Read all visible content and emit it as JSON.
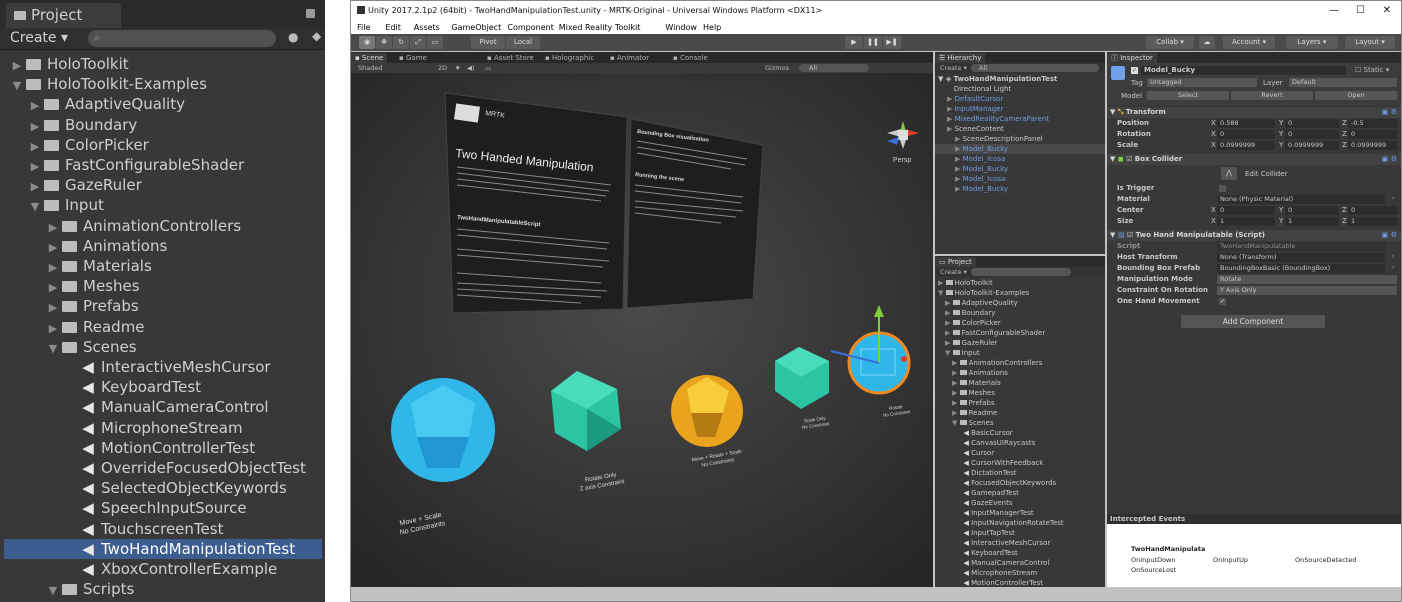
{
  "left_project": {
    "tab_title": "Project",
    "create_label": "Create",
    "tree": [
      {
        "label": "HoloToolkit",
        "depth": 0,
        "fold": "right",
        "icon": "folder"
      },
      {
        "label": "HoloToolkit-Examples",
        "depth": 0,
        "fold": "down",
        "icon": "folder"
      },
      {
        "label": "AdaptiveQuality",
        "depth": 1,
        "fold": "right",
        "icon": "folder"
      },
      {
        "label": "Boundary",
        "depth": 1,
        "fold": "right",
        "icon": "folder"
      },
      {
        "label": "ColorPicker",
        "depth": 1,
        "fold": "right",
        "icon": "folder"
      },
      {
        "label": "FastConfigurableShader",
        "depth": 1,
        "fold": "right",
        "icon": "folder"
      },
      {
        "label": "GazeRuler",
        "depth": 1,
        "fold": "right",
        "icon": "folder"
      },
      {
        "label": "Input",
        "depth": 1,
        "fold": "down",
        "icon": "folder"
      },
      {
        "label": "AnimationControllers",
        "depth": 2,
        "fold": "right",
        "icon": "folder"
      },
      {
        "label": "Animations",
        "depth": 2,
        "fold": "right",
        "icon": "folder"
      },
      {
        "label": "Materials",
        "depth": 2,
        "fold": "right",
        "icon": "folder"
      },
      {
        "label": "Meshes",
        "depth": 2,
        "fold": "right",
        "icon": "folder"
      },
      {
        "label": "Prefabs",
        "depth": 2,
        "fold": "right",
        "icon": "folder"
      },
      {
        "label": "Readme",
        "depth": 2,
        "fold": "right",
        "icon": "folder"
      },
      {
        "label": "Scenes",
        "depth": 2,
        "fold": "down",
        "icon": "folder"
      },
      {
        "label": "InteractiveMeshCursor",
        "depth": 3,
        "fold": "",
        "icon": "unity"
      },
      {
        "label": "KeyboardTest",
        "depth": 3,
        "fold": "",
        "icon": "unity"
      },
      {
        "label": "ManualCameraControl",
        "depth": 3,
        "fold": "",
        "icon": "unity"
      },
      {
        "label": "MicrophoneStream",
        "depth": 3,
        "fold": "",
        "icon": "unity"
      },
      {
        "label": "MotionControllerTest",
        "depth": 3,
        "fold": "",
        "icon": "unity"
      },
      {
        "label": "OverrideFocusedObjectTest",
        "depth": 3,
        "fold": "",
        "icon": "unity"
      },
      {
        "label": "SelectedObjectKeywords",
        "depth": 3,
        "fold": "",
        "icon": "unity"
      },
      {
        "label": "SpeechInputSource",
        "depth": 3,
        "fold": "",
        "icon": "unity"
      },
      {
        "label": "TouchscreenTest",
        "depth": 3,
        "fold": "",
        "icon": "unity"
      },
      {
        "label": "TwoHandManipulationTest",
        "depth": 3,
        "fold": "",
        "icon": "unity",
        "selected": true
      },
      {
        "label": "XboxControllerExample",
        "depth": 3,
        "fold": "",
        "icon": "unity"
      },
      {
        "label": "Scripts",
        "depth": 2,
        "fold": "down",
        "icon": "folder"
      }
    ]
  },
  "window": {
    "title": "Unity 2017.2.1p2 (64bit) - TwoHandManipulationTest.unity - MRTK-Original - Universal Windows Platform <DX11>",
    "menu": [
      "File",
      "Edit",
      "Assets",
      "GameObject",
      "Component",
      "Mixed Reality Toolkit",
      "Window",
      "Help"
    ]
  },
  "toolbar": {
    "pivot": "Pivot",
    "local": "Local",
    "collab": "Collab",
    "account": "Account",
    "layers": "Layers",
    "layout": "Layout"
  },
  "scene": {
    "tabs": [
      "Scene",
      "Game",
      "Asset Store",
      "Holographic",
      "Animator",
      "Console"
    ],
    "shaded": "Shaded",
    "mode_2d": "2D",
    "gizmos": "Gizmos",
    "all": "All",
    "persp": "Persp",
    "panel_title": "Two Handed Manipulation",
    "panel_heading2": "TwoHandManipulatableScript",
    "panel_right_heading": "Bounding Box visualization",
    "panel_right_heading2": "Running the scene",
    "brand": "MRTK",
    "labels": [
      "Move + Scale\nNo Constraints",
      "Rotate Only\nZ axis Constraint",
      "Move + Rotate + Scale\nNo Constraints",
      "Scale Only\nNo Constraint",
      "Rotate\nNo Constraint"
    ]
  },
  "hierarchy": {
    "tab": "Hierarchy",
    "create": "Create",
    "all": "All",
    "root": "TwoHandManipulationTest",
    "items": [
      {
        "label": "Directional Light",
        "indent": 1,
        "blue": false
      },
      {
        "label": "DefaultCursor",
        "indent": 1,
        "blue": true,
        "fold": true
      },
      {
        "label": "InputManager",
        "indent": 1,
        "blue": true,
        "fold": true
      },
      {
        "label": "MixedRealityCameraParent",
        "indent": 1,
        "blue": true,
        "fold": true
      },
      {
        "label": "SceneContent",
        "indent": 1,
        "blue": false,
        "fold": true
      },
      {
        "label": "SceneDescriptionPanel",
        "indent": 2,
        "blue": false,
        "fold": true
      },
      {
        "label": "Model_Bucky",
        "indent": 2,
        "blue": true,
        "fold": true,
        "selected": true
      },
      {
        "label": "Model_Icosa",
        "indent": 2,
        "blue": true,
        "fold": true
      },
      {
        "label": "Model_Bucky",
        "indent": 2,
        "blue": true,
        "fold": true
      },
      {
        "label": "Model_Icosa",
        "indent": 2,
        "blue": true,
        "fold": true
      },
      {
        "label": "Model_Bucky",
        "indent": 2,
        "blue": true,
        "fold": true
      }
    ]
  },
  "project_small": {
    "tab": "Project",
    "create": "Create",
    "items": [
      {
        "label": "HoloToolkit",
        "d": 0,
        "f": "r",
        "i": "folder"
      },
      {
        "label": "HoloToolkit-Examples",
        "d": 0,
        "f": "d",
        "i": "folder"
      },
      {
        "label": "AdaptiveQuality",
        "d": 1,
        "f": "r",
        "i": "folder"
      },
      {
        "label": "Boundary",
        "d": 1,
        "f": "r",
        "i": "folder"
      },
      {
        "label": "ColorPicker",
        "d": 1,
        "f": "r",
        "i": "folder"
      },
      {
        "label": "FastConfigurableShader",
        "d": 1,
        "f": "r",
        "i": "folder"
      },
      {
        "label": "GazeRuler",
        "d": 1,
        "f": "r",
        "i": "folder"
      },
      {
        "label": "Input",
        "d": 1,
        "f": "d",
        "i": "folder"
      },
      {
        "label": "AnimationControllers",
        "d": 2,
        "f": "r",
        "i": "folder"
      },
      {
        "label": "Animations",
        "d": 2,
        "f": "r",
        "i": "folder"
      },
      {
        "label": "Materials",
        "d": 2,
        "f": "r",
        "i": "folder"
      },
      {
        "label": "Meshes",
        "d": 2,
        "f": "r",
        "i": "folder"
      },
      {
        "label": "Prefabs",
        "d": 2,
        "f": "r",
        "i": "folder"
      },
      {
        "label": "Readme",
        "d": 2,
        "f": "r",
        "i": "folder"
      },
      {
        "label": "Scenes",
        "d": 2,
        "f": "d",
        "i": "folder"
      },
      {
        "label": "BasicCursor",
        "d": 3,
        "f": "",
        "i": "unity"
      },
      {
        "label": "CanvasUIRaycasts",
        "d": 3,
        "f": "",
        "i": "unity"
      },
      {
        "label": "Cursor",
        "d": 3,
        "f": "",
        "i": "unity"
      },
      {
        "label": "CursorWithFeedback",
        "d": 3,
        "f": "",
        "i": "unity"
      },
      {
        "label": "DictationTest",
        "d": 3,
        "f": "",
        "i": "unity"
      },
      {
        "label": "FocusedObjectKeywords",
        "d": 3,
        "f": "",
        "i": "unity"
      },
      {
        "label": "GamepadTest",
        "d": 3,
        "f": "",
        "i": "unity"
      },
      {
        "label": "GazeEvents",
        "d": 3,
        "f": "",
        "i": "unity"
      },
      {
        "label": "InputManagerTest",
        "d": 3,
        "f": "",
        "i": "unity"
      },
      {
        "label": "InputNavigationRotateTest",
        "d": 3,
        "f": "",
        "i": "unity"
      },
      {
        "label": "InputTapTest",
        "d": 3,
        "f": "",
        "i": "unity"
      },
      {
        "label": "InteractiveMeshCursor",
        "d": 3,
        "f": "",
        "i": "unity"
      },
      {
        "label": "KeyboardTest",
        "d": 3,
        "f": "",
        "i": "unity"
      },
      {
        "label": "ManualCameraControl",
        "d": 3,
        "f": "",
        "i": "unity"
      },
      {
        "label": "MicrophoneStream",
        "d": 3,
        "f": "",
        "i": "unity"
      },
      {
        "label": "MotionControllerTest",
        "d": 3,
        "f": "",
        "i": "unity"
      }
    ]
  },
  "inspector": {
    "tab": "Inspector",
    "object_name": "Model_Bucky",
    "static_label": "Static",
    "tag_label": "Tag",
    "tag_value": "Untagged",
    "layer_label": "Layer",
    "layer_value": "Default",
    "model_label": "Model",
    "select_btn": "Select",
    "revert_btn": "Revert",
    "open_btn": "Open",
    "transform": {
      "title": "Transform",
      "position_label": "Position",
      "position": [
        "0.588",
        "0",
        "-0.5"
      ],
      "rotation_label": "Rotation",
      "rotation": [
        "0",
        "0",
        "0"
      ],
      "scale_label": "Scale",
      "scale": [
        "0.0999999",
        "0.0999999",
        "0.0999999"
      ]
    },
    "box_collider": {
      "title": "Box Collider",
      "edit_label": "Edit Collider",
      "is_trigger_label": "Is Trigger",
      "material_label": "Material",
      "material_value": "None (Physic Material)",
      "center_label": "Center",
      "center": [
        "0",
        "0",
        "0"
      ],
      "size_label": "Size",
      "size": [
        "1",
        "1",
        "1"
      ]
    },
    "two_hand": {
      "title": "Two Hand Manipulatable (Script)",
      "script_label": "Script",
      "script_value": "TwoHandManipulatable",
      "host_label": "Host Transform",
      "host_value": "None (Transform)",
      "bbox_label": "Bounding Box Prefab",
      "bbox_value": "BoundingBoxBasic (BoundingBox)",
      "mode_label": "Manipulation Mode",
      "mode_value": "Rotate",
      "constraint_label": "Constraint On Rotation",
      "constraint_value": "Y Axis Only",
      "one_hand_label": "One Hand Movement"
    },
    "add_component": "Add Component",
    "intercepted_title": "Intercepted Events",
    "events_object": "TwoHandManipulata",
    "events": [
      "OnInputDown",
      "OnInputUp",
      "OnSourceDetected",
      "OnSourceLost"
    ],
    "axis_x": "X",
    "axis_y": "Y",
    "axis_z": "Z"
  }
}
